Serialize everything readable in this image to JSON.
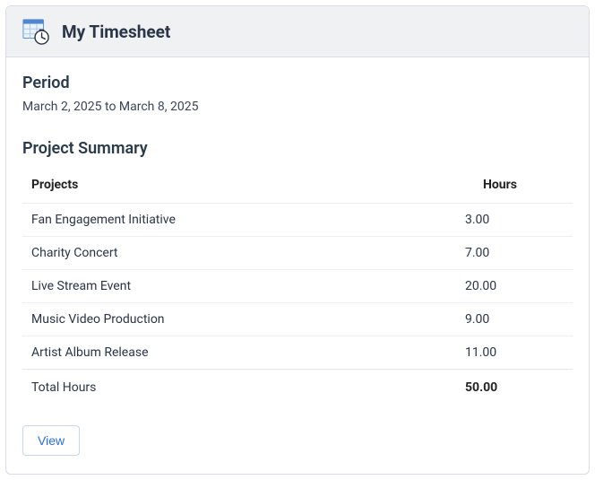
{
  "header": {
    "title": "My Timesheet"
  },
  "period": {
    "heading": "Period",
    "text": "March 2, 2025 to March 8, 2025"
  },
  "summary": {
    "heading": "Project Summary",
    "columns": {
      "projects": "Projects",
      "hours": "Hours"
    },
    "rows": [
      {
        "project": "Fan Engagement Initiative",
        "hours": "3.00"
      },
      {
        "project": "Charity Concert",
        "hours": "7.00"
      },
      {
        "project": "Live Stream Event",
        "hours": "20.00"
      },
      {
        "project": "Music Video Production",
        "hours": "9.00"
      },
      {
        "project": "Artist Album Release",
        "hours": "11.00"
      }
    ],
    "total": {
      "label": "Total Hours",
      "value": "50.00"
    }
  },
  "actions": {
    "view": "View"
  }
}
